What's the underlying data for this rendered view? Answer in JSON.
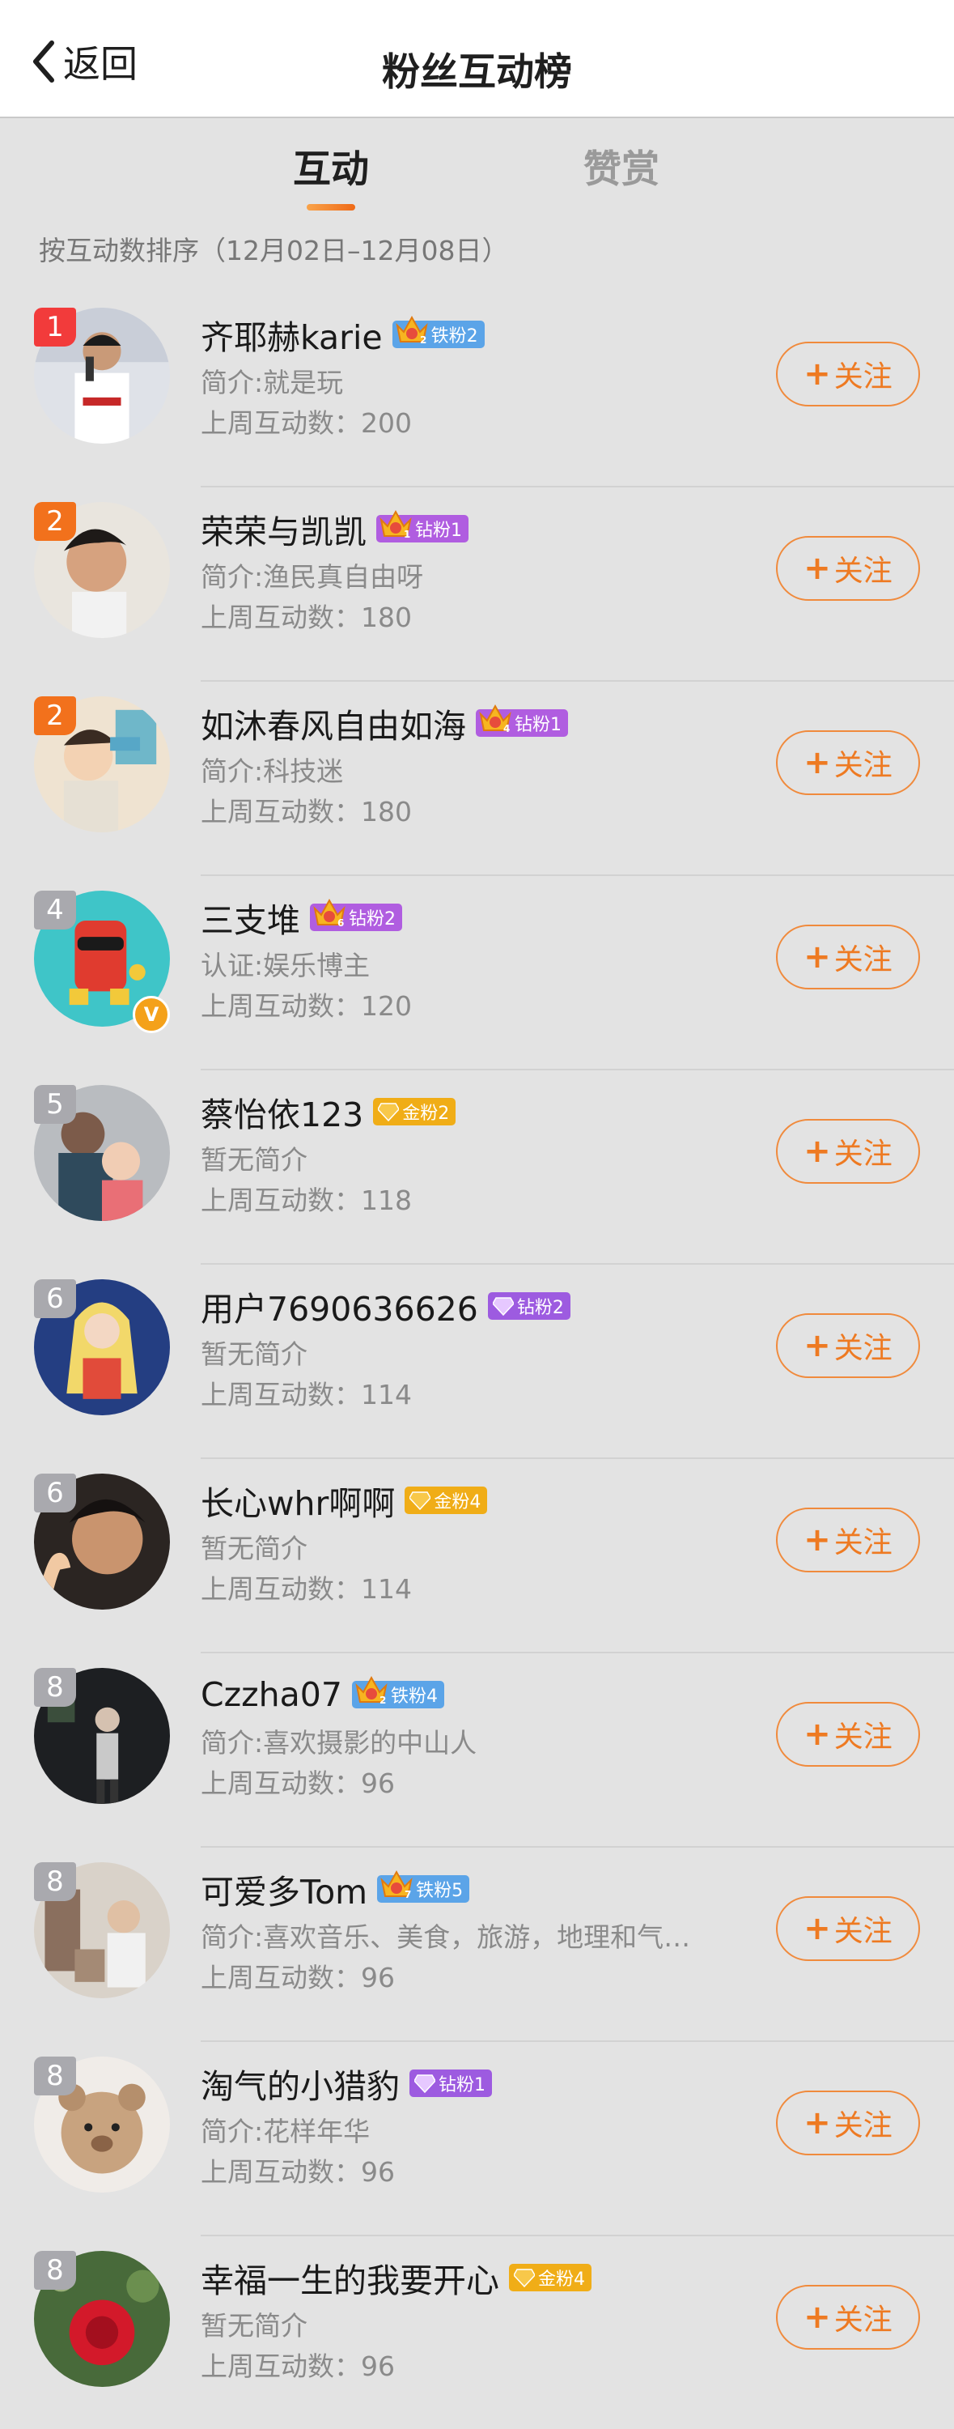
{
  "header": {
    "back_label": "返回",
    "title": "粉丝互动榜"
  },
  "tabs": [
    {
      "label": "互动",
      "active": true
    },
    {
      "label": "赞赏",
      "active": false
    }
  ],
  "sort_text": "按互动数排序（12月02日–12月08日）",
  "follow_label": "关注",
  "colors": {
    "accent": "#ee7a22",
    "rank1": "#f23b3b",
    "rank2": "#f2711c",
    "rank_other": "#a9a9ae"
  },
  "fans": [
    {
      "rank": "1",
      "name": "齐耶赫karie",
      "badge_type": "iron",
      "badge_level": "2",
      "badge_label": "铁粉2",
      "desc": "简介:就是玩",
      "count": "上周互动数：200",
      "avatar": "athlete"
    },
    {
      "rank": "2",
      "name": "荣荣与凯凯",
      "badge_type": "diamond",
      "badge_level": "1",
      "badge_label": "钻粉1",
      "desc": "简介:渔民真自由呀",
      "count": "上周互动数：180",
      "avatar": "man"
    },
    {
      "rank": "2",
      "name": "如沐春风自由如海",
      "badge_type": "diamond",
      "badge_level": "4",
      "badge_label": "钻粉1",
      "desc": "简介:科技迷",
      "count": "上周互动数：180",
      "avatar": "cartoon"
    },
    {
      "rank": "4",
      "name": "三支堆",
      "badge_type": "diamond",
      "badge_level": "6",
      "badge_label": "钻粉2",
      "desc": "认证:娱乐博主",
      "count": "上周互动数：120",
      "avatar": "robot",
      "verified": "V"
    },
    {
      "rank": "5",
      "name": "蔡怡依123",
      "badge_type": "gold",
      "badge_level": "",
      "badge_label": "金粉2",
      "desc": "暂无简介",
      "count": "上周互动数：118",
      "avatar": "family"
    },
    {
      "rank": "6",
      "name": "用户7690636626",
      "badge_type": "diamondgem",
      "badge_level": "",
      "badge_label": "钻粉2",
      "desc": "暂无简介",
      "count": "上周互动数：114",
      "avatar": "girl"
    },
    {
      "rank": "6",
      "name": "长心whr啊啊",
      "badge_type": "gold",
      "badge_level": "",
      "badge_label": "金粉4",
      "desc": "暂无简介",
      "count": "上周互动数：114",
      "avatar": "boy"
    },
    {
      "rank": "8",
      "name": "Czzha07",
      "badge_type": "iron",
      "badge_level": "2",
      "badge_label": "铁粉4",
      "desc": "简介:喜欢摄影的中山人",
      "count": "上周互动数：96",
      "avatar": "night"
    },
    {
      "rank": "8",
      "name": "可爱多Tom",
      "badge_type": "iron",
      "badge_level": "7",
      "badge_label": "铁粉5",
      "desc": "简介:喜欢音乐、美食，旅游，地理和气…",
      "count": "上周互动数：96",
      "avatar": "room"
    },
    {
      "rank": "8",
      "name": "淘气的小猎豹",
      "badge_type": "diamondgem",
      "badge_level": "",
      "badge_label": "钻粉1",
      "desc": "简介:花样年华",
      "count": "上周互动数：96",
      "avatar": "bear"
    },
    {
      "rank": "8",
      "name": "幸福一生的我要开心",
      "badge_type": "gold",
      "badge_level": "",
      "badge_label": "金粉4",
      "desc": "暂无简介",
      "count": "上周互动数：96",
      "avatar": "rose"
    }
  ]
}
